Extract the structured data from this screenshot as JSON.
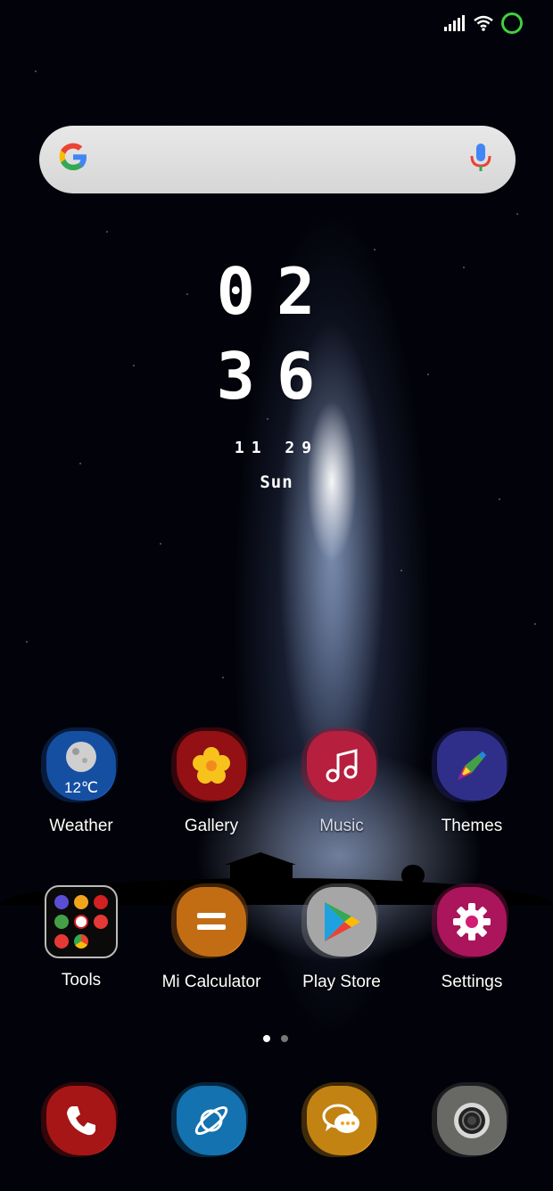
{
  "status_bar": {
    "signal_icon": "signal-bars-icon",
    "wifi_icon": "wifi-icon",
    "battery_icon": "battery-ring-icon",
    "battery_color": "#3ed13e"
  },
  "search": {
    "logo": "G",
    "placeholder": "",
    "mic_icon": "mic-icon"
  },
  "clock": {
    "hours": "02",
    "minutes": "36",
    "date": "11 29",
    "weekday": "Sun"
  },
  "apps": [
    {
      "label": "Weather",
      "badge": "12℃",
      "color": "#1d61c4"
    },
    {
      "label": "Gallery",
      "color": "#b3141a"
    },
    {
      "label": "Music",
      "color": "#d8294a"
    },
    {
      "label": "Themes",
      "color": "#3c3ca8"
    },
    {
      "label": "Tools"
    },
    {
      "label": "Mi Calculator",
      "color": "#f08a1d"
    },
    {
      "label": "Play Store",
      "color": "#bdbdbd"
    },
    {
      "label": "Settings",
      "color": "#d11d72"
    }
  ],
  "dock": [
    {
      "name": "phone",
      "color": "#d32020"
    },
    {
      "name": "browser",
      "color": "#1a8fd9"
    },
    {
      "name": "messages",
      "color": "#f2a51c"
    },
    {
      "name": "camera",
      "color": "#8a8a88"
    }
  ],
  "pages": {
    "count": 2,
    "current": 1
  }
}
